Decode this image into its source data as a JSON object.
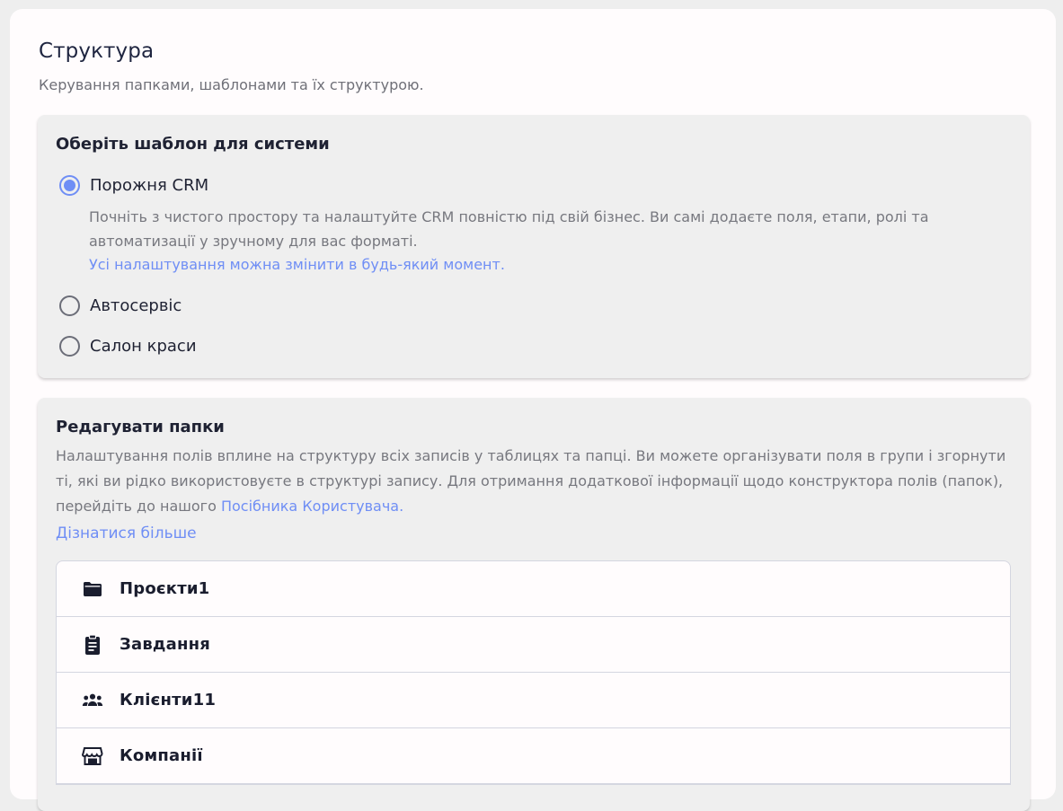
{
  "page": {
    "title": "Структура",
    "subtitle": "Керування папками, шаблонами та їх структурою."
  },
  "template_panel": {
    "heading": "Оберіть шаблон для системи",
    "options": [
      {
        "label": "Порожня CRM",
        "checked": true
      },
      {
        "label": "Автосервіс",
        "checked": false
      },
      {
        "label": "Салон краси",
        "checked": false
      }
    ],
    "selected_description": "Почніть з чистого простору та налаштуйте CRM повністю під свій бізнес. Ви самі додаєте поля, етапи, ролі та автоматизації у зручному для вас форматі.",
    "selected_note": "Усі налаштування можна змінити в будь-який момент."
  },
  "folders_panel": {
    "heading": "Редагувати папки",
    "description": "Налаштування полів вплине на структуру всіх записів у таблицях та папці. Ви можете організувати поля в групи і згорнути ті, які ви рідко використовуєте в структурі запису. Для отримання додаткової інформації щодо конструктора полів (папок), перейдіть до нашого",
    "guide_link": "Посібника Користувача",
    "guide_link_suffix": ".",
    "learn_more": "Дізнатися більше",
    "folders": [
      {
        "label": "Проєкти1",
        "icon": "folder-icon"
      },
      {
        "label": "Завдання",
        "icon": "clipboard-icon"
      },
      {
        "label": "Клієнти11",
        "icon": "users-icon"
      },
      {
        "label": "Компанії",
        "icon": "store-icon"
      }
    ]
  },
  "colors": {
    "accent": "#6f8ef5",
    "text": "#1f2233",
    "muted": "#77787f"
  }
}
